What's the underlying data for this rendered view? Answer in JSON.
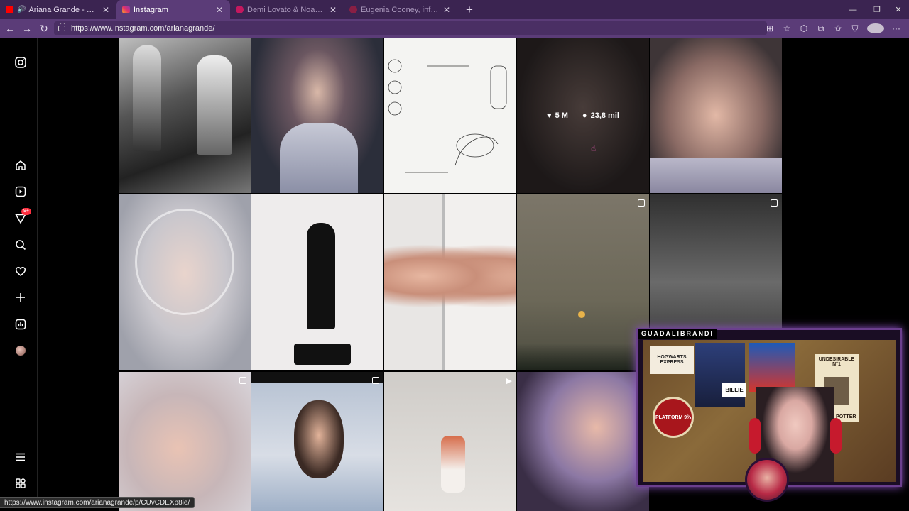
{
  "browser": {
    "tabs": [
      {
        "label": "Ariana Grande - kiss me (offic",
        "favicon_color": "#ff0000",
        "state": "audio"
      },
      {
        "label": "Instagram",
        "favicon_color": "#e1306c",
        "state": "active"
      },
      {
        "label": "Demi Lovato & Noah Cyrus - Easy",
        "favicon_color": "#c4185e",
        "state": "inactive"
      },
      {
        "label": "Eugenia Cooney, influencer sufre",
        "favicon_color": "#8a1f44",
        "state": "inactive"
      }
    ],
    "url": "https://www.instagram.com/arianagrande/",
    "status_url": "https://www.instagram.com/arianagrande/p/CUvCDEXp8ie/"
  },
  "sidebar": {
    "items": [
      {
        "name": "instagram-logo-icon"
      },
      {
        "name": "home-icon"
      },
      {
        "name": "reels-icon"
      },
      {
        "name": "messages-icon",
        "badge": "9+"
      },
      {
        "name": "search-icon"
      },
      {
        "name": "notifications-heart-icon"
      },
      {
        "name": "create-plus-icon"
      },
      {
        "name": "dashboard-icon"
      },
      {
        "name": "profile-avatar-icon"
      },
      {
        "name": "more-menu-icon"
      },
      {
        "name": "also-from-meta-icon"
      }
    ]
  },
  "hovered_post": {
    "likes": "5 M",
    "comments": "23,8 mil"
  },
  "webcam": {
    "streamer_name": "GUADALIBRANDI",
    "poster_1": "UNDESIRABLE N°1",
    "poster_2": "HARRY POTTER",
    "poster_3": "HOGWARTS EXPRESS",
    "poster_4": "PLATFORM 9¾",
    "poster_5": "BILLIE"
  },
  "colors": {
    "tabbar": "#3b2451",
    "addressbar": "#5b3c78",
    "badge": "#ff3040"
  }
}
